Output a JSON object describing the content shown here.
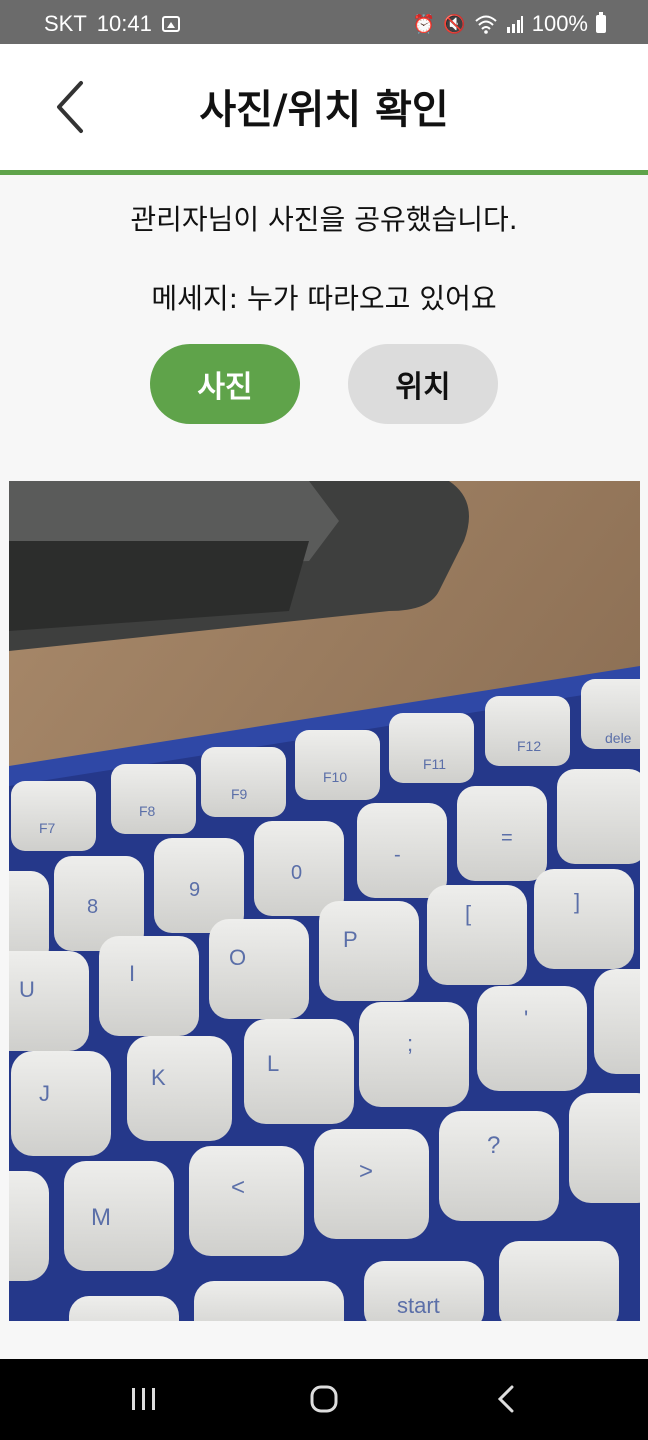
{
  "status_bar": {
    "carrier": "SKT",
    "time": "10:41",
    "battery": "100%",
    "icons": [
      "gallery-icon",
      "alarm-icon",
      "mute-icon",
      "wifi-icon",
      "signal-icon",
      "battery-icon"
    ]
  },
  "header": {
    "title": "사진/위치 확인",
    "back_icon": "chevron-left-icon"
  },
  "content": {
    "message_line1": "관리자님이 사진을 공유했습니다.",
    "message_line2": "메세지: 누가 따라오고 있어요"
  },
  "toggle": {
    "photo_label": "사진",
    "location_label": "위치",
    "selected": "사진"
  },
  "photo": {
    "description_keys": [
      "F7",
      "F8",
      "F9",
      "F10",
      "F11",
      "F12",
      "8",
      "9",
      "0",
      "-",
      "=",
      "[",
      "]",
      "U",
      "I",
      "O",
      "P",
      ";",
      "'",
      "J",
      "K",
      "L",
      "M",
      "<",
      ">",
      "?",
      "/",
      "start"
    ]
  },
  "nav": {
    "recent_icon": "recent-apps-icon",
    "home_icon": "home-icon",
    "back_icon": "back-icon"
  },
  "colors": {
    "accent_green": "#5fa34a",
    "status_bar": "#6b6b6b",
    "inactive_button": "#dcdcdc",
    "nav_bar": "#000000"
  }
}
